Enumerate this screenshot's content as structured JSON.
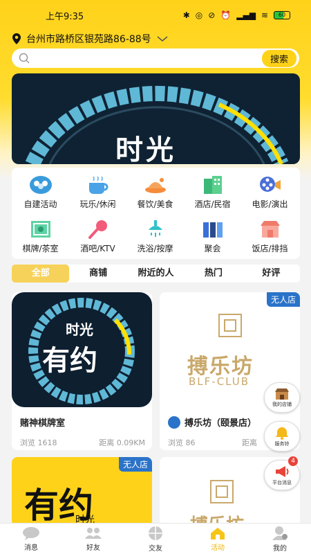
{
  "status_bar": {
    "time": "上午9:35",
    "battery": "60"
  },
  "location": {
    "address": "台州市路桥区银苑路86-88号"
  },
  "search": {
    "placeholder": "",
    "button_label": "搜索"
  },
  "banner": {
    "title": "时光"
  },
  "categories": [
    {
      "label": "自建活动",
      "icon": "group-icon"
    },
    {
      "label": "玩乐/休闲",
      "icon": "coffee-icon"
    },
    {
      "label": "餐饮/美食",
      "icon": "food-icon"
    },
    {
      "label": "酒店/民宿",
      "icon": "hotel-icon"
    },
    {
      "label": "电影/演出",
      "icon": "film-icon"
    },
    {
      "label": "棋牌/茶室",
      "icon": "chess-icon"
    },
    {
      "label": "酒吧/KTV",
      "icon": "microphone-icon"
    },
    {
      "label": "洗浴/按摩",
      "icon": "shower-icon"
    },
    {
      "label": "聚会",
      "icon": "party-icon"
    },
    {
      "label": "饭店/排挡",
      "icon": "restaurant-icon"
    }
  ],
  "tabs": [
    {
      "label": "全部",
      "active": true
    },
    {
      "label": "商铺"
    },
    {
      "label": "附近的人"
    },
    {
      "label": "热门"
    },
    {
      "label": "好评"
    }
  ],
  "cards": [
    {
      "name": "赌神棋牌室",
      "views": "浏览 1618",
      "distance": "距离 0.09KM",
      "image_text_top": "时光",
      "image_text_main": "有约"
    },
    {
      "name": "搏乐坊（颐景店）",
      "views": "浏览 86",
      "distance": "距离",
      "badge": "无人店",
      "image_text_main": "搏乐坊",
      "image_text_sub": "BLF-CLUB"
    },
    {
      "badge": "无人店",
      "image_text_main": "有约",
      "image_text_sub": "时光"
    },
    {
      "image_text_main": "搏乐坊"
    }
  ],
  "float_buttons": [
    {
      "label": "我的店铺",
      "icon": "shop-icon"
    },
    {
      "label": "服务铃",
      "icon": "bell-icon"
    },
    {
      "label": "平台消息",
      "icon": "megaphone-icon",
      "count": "4"
    }
  ],
  "bottom_nav": [
    {
      "label": "消息",
      "icon": "chat-icon"
    },
    {
      "label": "好友",
      "icon": "friends-icon"
    },
    {
      "label": "交友",
      "icon": "globe-icon"
    },
    {
      "label": "活动",
      "icon": "home-icon",
      "active": true
    },
    {
      "label": "我的",
      "icon": "user-icon"
    }
  ],
  "colors": {
    "accent": "#ffd21a",
    "tab_active": "#f7d25a",
    "badge": "#2a73c9",
    "nav_active": "#f0b400"
  }
}
